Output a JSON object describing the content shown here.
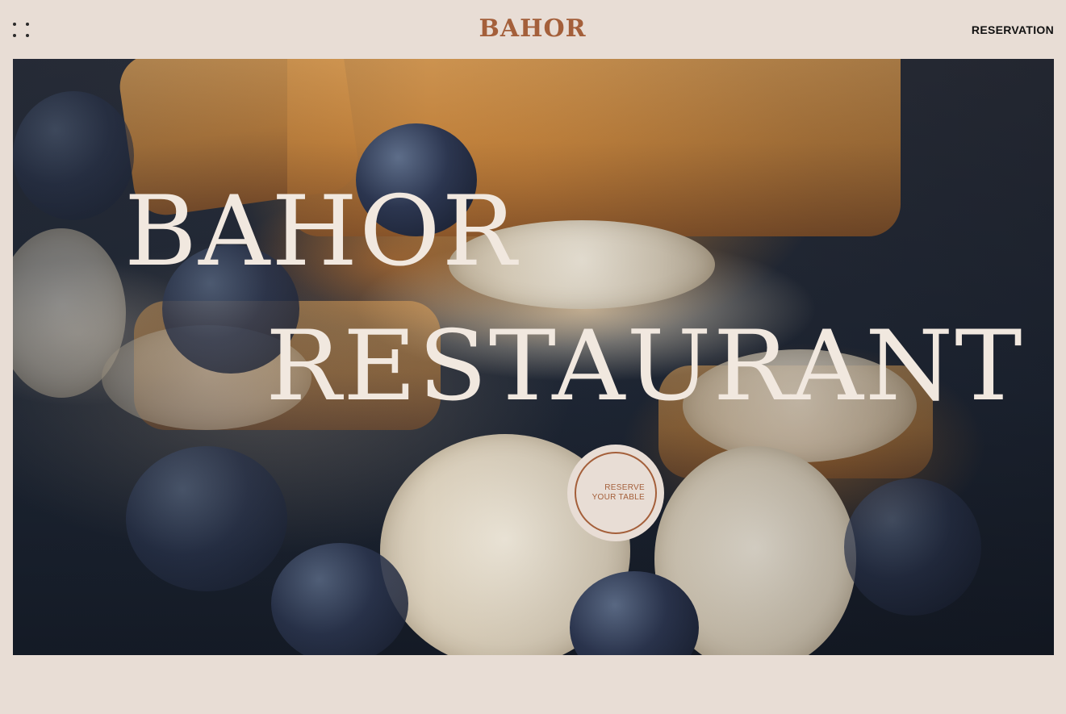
{
  "header": {
    "brand": "BAHOR",
    "reservation_label": "RESERVATION"
  },
  "hero": {
    "title_line1": "BAHOR",
    "title_line2": "RESTAURANT",
    "cta_line1": "RESERVE",
    "cta_line2": "YOUR TABLE"
  },
  "icons": {
    "menu": "dots-menu-icon"
  },
  "colors": {
    "background": "#e8ddd5",
    "accent": "#a45f3a",
    "hero_text": "#f1e8df",
    "nav_text": "#111111"
  }
}
